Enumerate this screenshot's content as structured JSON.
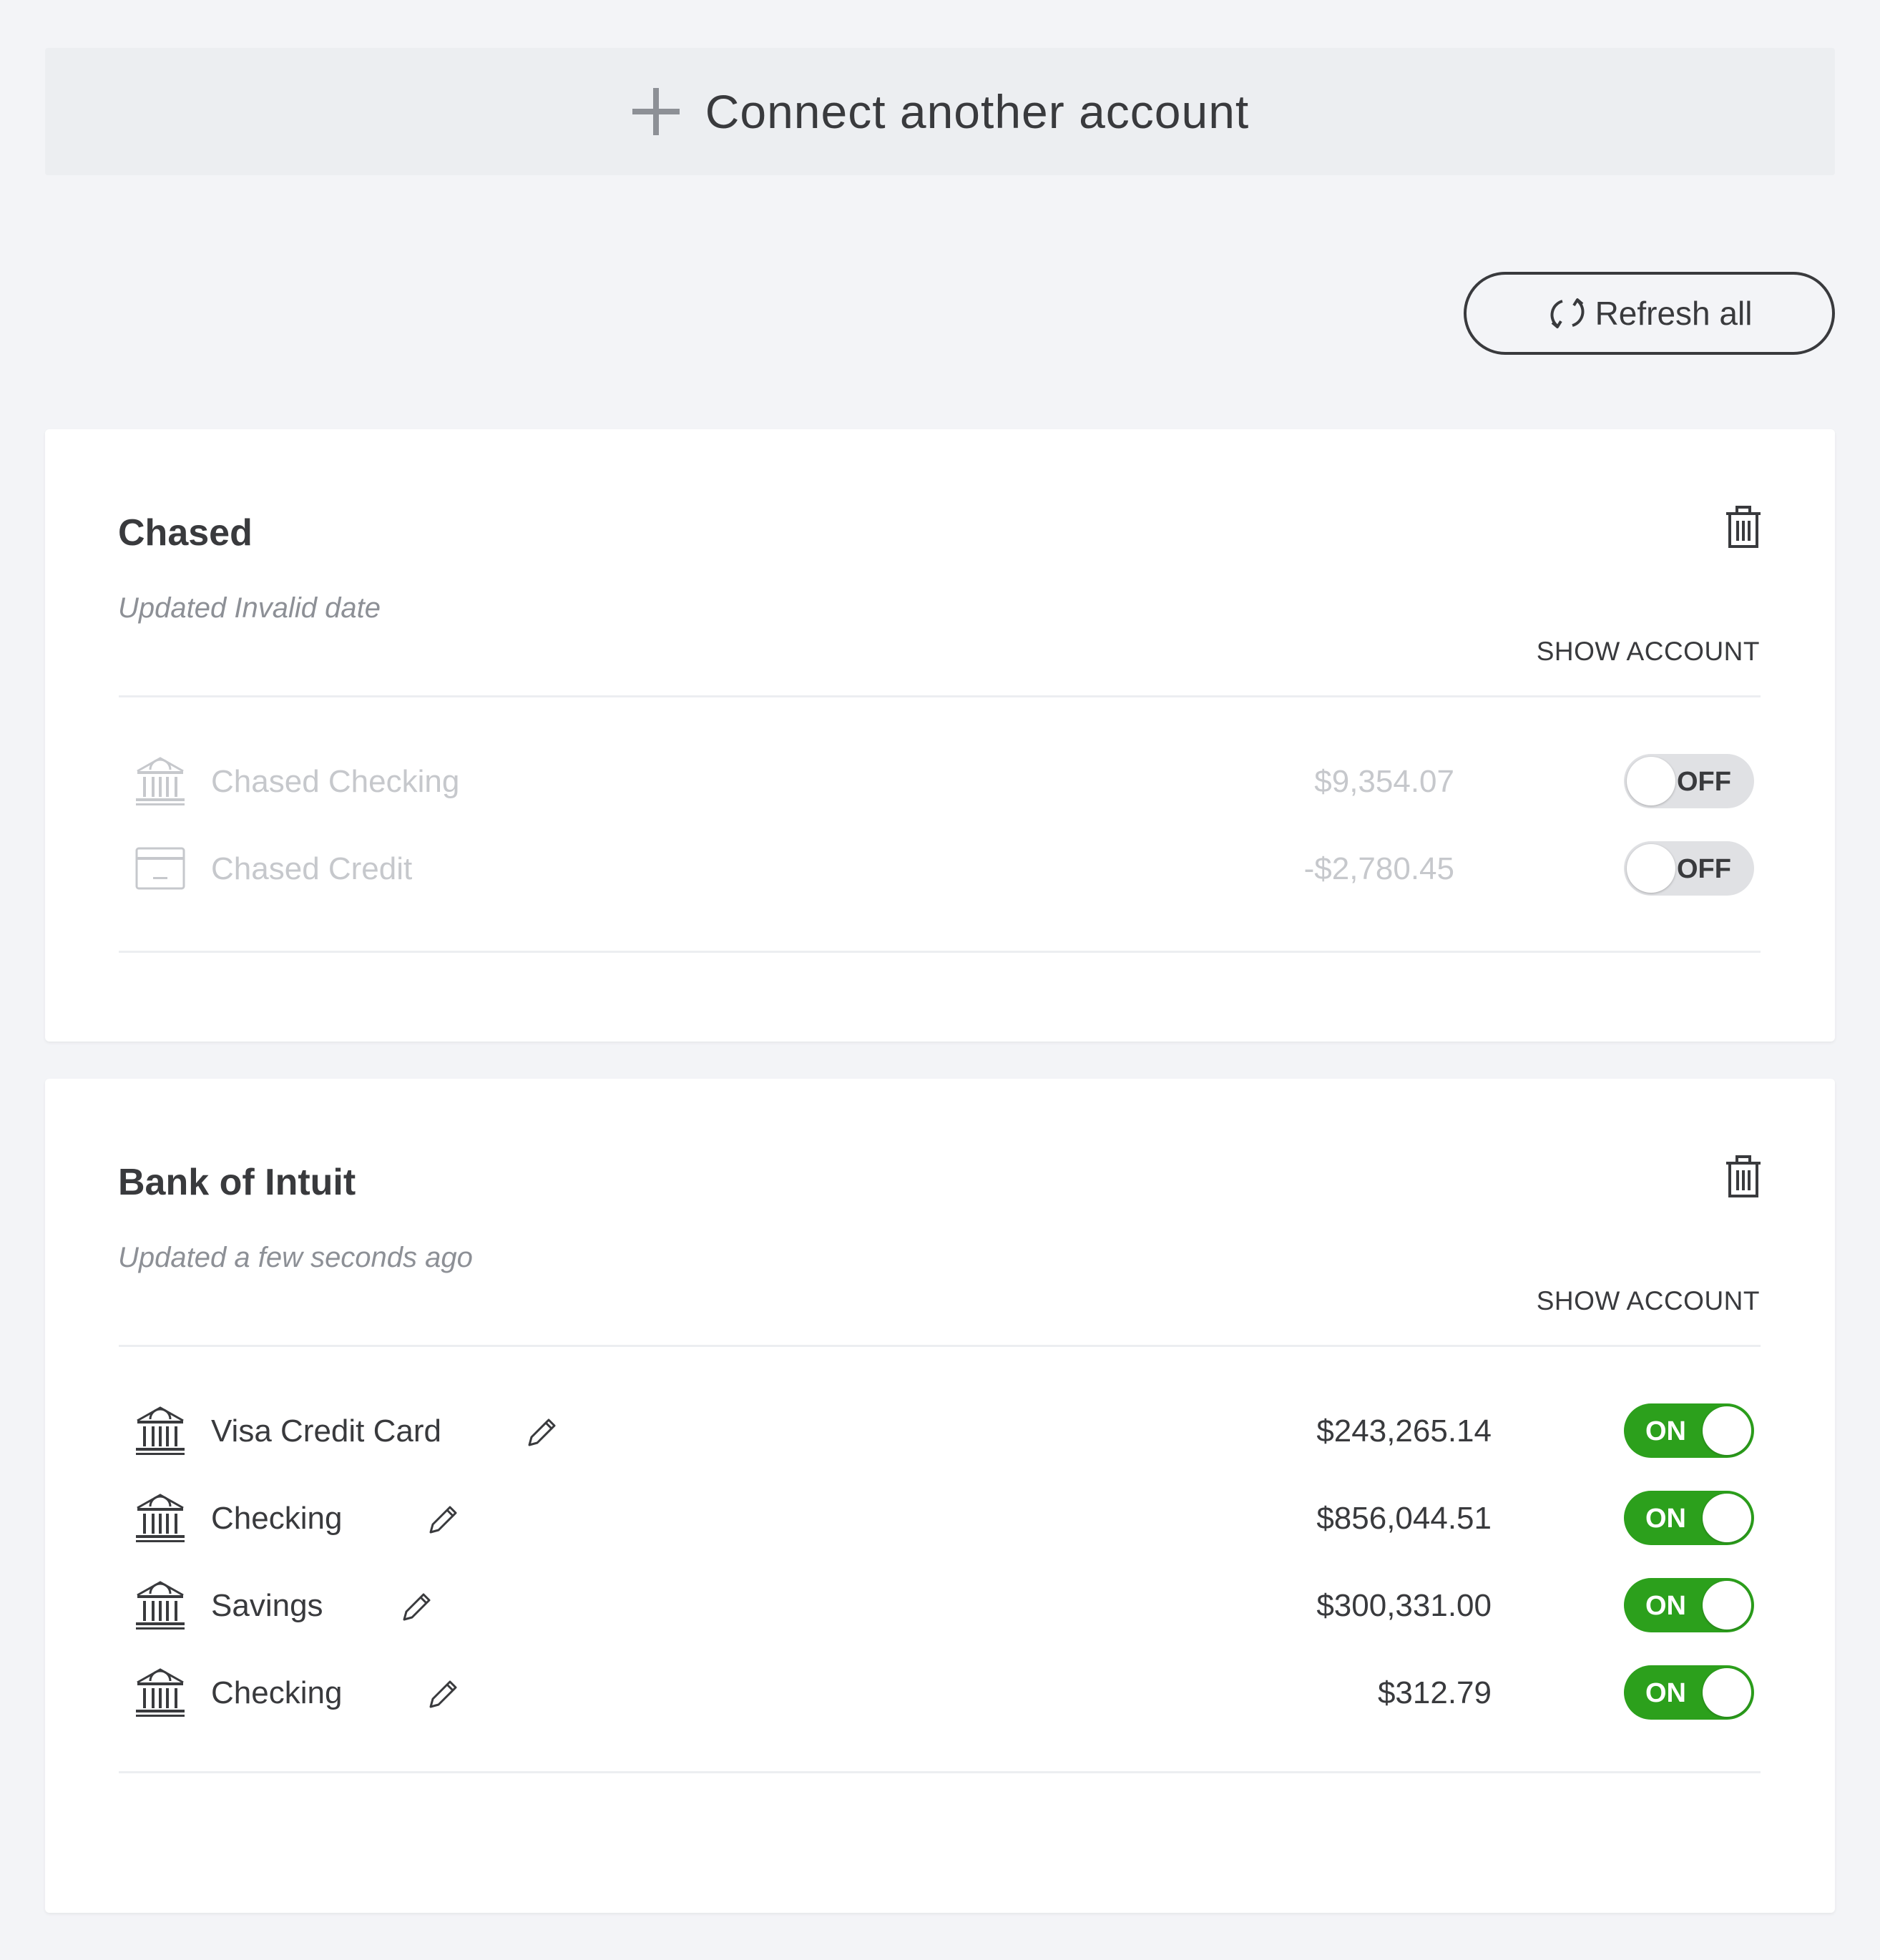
{
  "connect": {
    "label": "Connect another account",
    "icon": "plus-icon"
  },
  "refresh": {
    "label": "Refresh all",
    "icon": "refresh-icon"
  },
  "colors": {
    "toggle_on": "#2ca01c",
    "toggle_off": "#e0e1e4",
    "text": "#393a3d",
    "muted": "#8d9096",
    "disabled": "#c6c8cc"
  },
  "banks": [
    {
      "name": "Chased",
      "updated": "Updated Invalid date",
      "show_account": "SHOW ACCOUNT",
      "accounts": [
        {
          "name": "Chased Checking",
          "amount": "$9,354.07",
          "icon": "bank-icon",
          "toggle": "OFF"
        },
        {
          "name": "Chased Credit",
          "amount": "-$2,780.45",
          "icon": "credit-card-icon",
          "toggle": "OFF"
        }
      ]
    },
    {
      "name": "Bank of Intuit",
      "updated": "Updated a few seconds ago",
      "show_account": "SHOW ACCOUNT",
      "accounts": [
        {
          "name": "Visa Credit Card",
          "amount": "$243,265.14",
          "icon": "bank-icon",
          "toggle": "ON"
        },
        {
          "name": "Checking",
          "amount": "$856,044.51",
          "icon": "bank-icon",
          "toggle": "ON"
        },
        {
          "name": "Savings",
          "amount": "$300,331.00",
          "icon": "bank-icon",
          "toggle": "ON"
        },
        {
          "name": "Checking",
          "amount": "$312.79",
          "icon": "bank-icon",
          "toggle": "ON"
        }
      ]
    }
  ]
}
